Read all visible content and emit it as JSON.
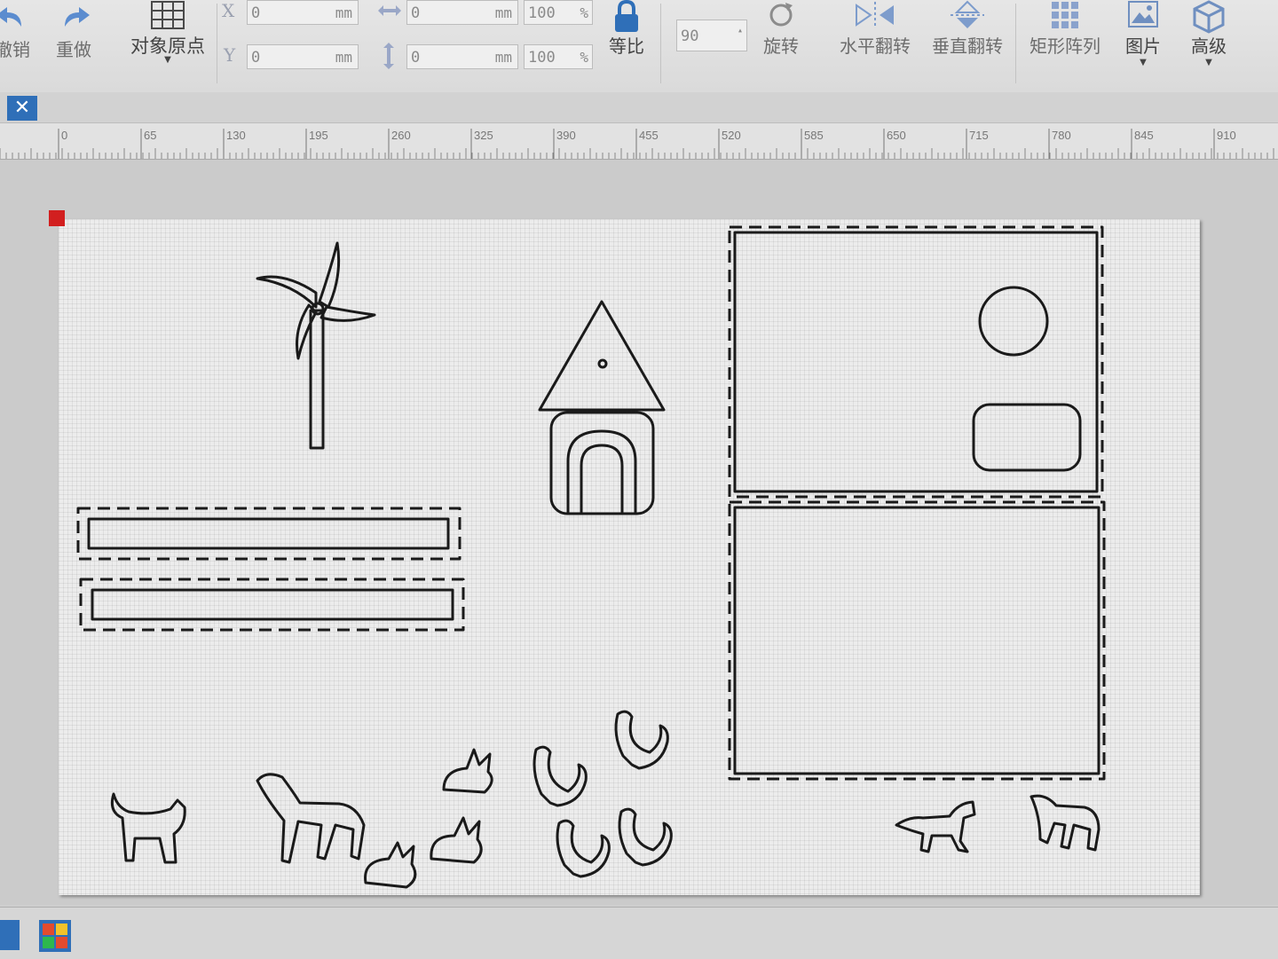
{
  "toolbar": {
    "undo_label": "撤销",
    "redo_label": "重做",
    "origin_label": "对象原点",
    "x_label": "X",
    "y_label": "Y",
    "x_value": "0",
    "y_value": "0",
    "x_unit": "mm",
    "y_unit": "mm",
    "width_value": "0",
    "height_value": "0",
    "width_unit": "mm",
    "height_unit": "mm",
    "width_scale": "100",
    "height_scale": "100",
    "width_scale_unit": "%",
    "height_scale_unit": "%",
    "ratio_label": "等比",
    "rotation_value": "90",
    "rotate_label": "旋转",
    "flip_h_label": "水平翻转",
    "flip_v_label": "垂直翻转",
    "array_label": "矩形阵列",
    "image_label": "图片",
    "advanced_label": "高级"
  },
  "ruler": {
    "ticks": [
      "0",
      "65",
      "130",
      "195",
      "260",
      "325",
      "390",
      "455",
      "520",
      "585",
      "650",
      "715",
      "780",
      "845",
      "910"
    ]
  },
  "tab": {
    "close_symbol": "✕"
  },
  "colors": {
    "accent": "#2f6fb8",
    "origin": "#d21f1f",
    "stroke": "#1a1a1a"
  }
}
